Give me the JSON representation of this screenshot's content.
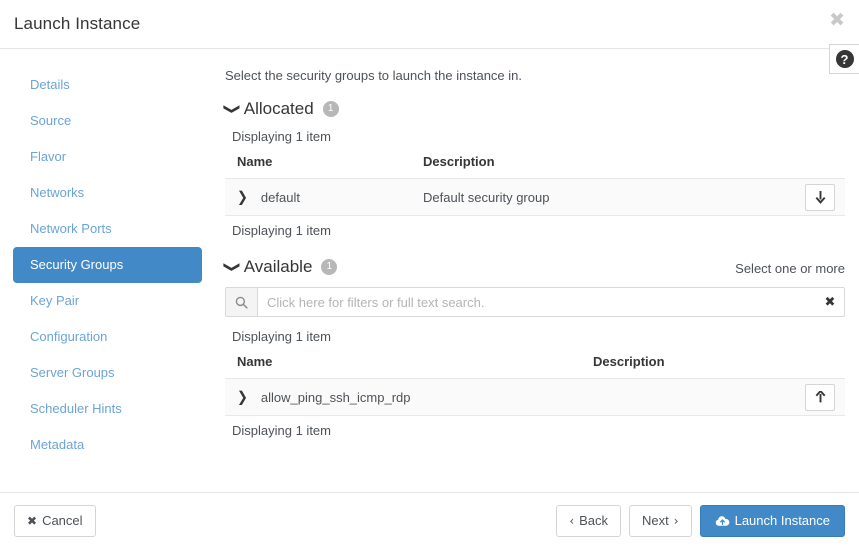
{
  "window": {
    "title": "Launch Instance",
    "close_label": "✖",
    "help_label": "?"
  },
  "sidebar": {
    "items": [
      {
        "label": "Details",
        "active": false
      },
      {
        "label": "Source",
        "active": false
      },
      {
        "label": "Flavor",
        "active": false
      },
      {
        "label": "Networks",
        "active": false
      },
      {
        "label": "Network Ports",
        "active": false
      },
      {
        "label": "Security Groups",
        "active": true
      },
      {
        "label": "Key Pair",
        "active": false
      },
      {
        "label": "Configuration",
        "active": false
      },
      {
        "label": "Server Groups",
        "active": false
      },
      {
        "label": "Scheduler Hints",
        "active": false
      },
      {
        "label": "Metadata",
        "active": false
      }
    ]
  },
  "main": {
    "intro": "Select the security groups to launch the instance in.",
    "allocated": {
      "title": "Allocated",
      "badge": "1",
      "count_top": "Displaying 1 item",
      "count_bottom": "Displaying 1 item",
      "columns": {
        "name": "Name",
        "description": "Description"
      },
      "rows": [
        {
          "name": "default",
          "description": "Default security group",
          "action_icon": "arrow-down-icon"
        }
      ]
    },
    "available": {
      "title": "Available",
      "badge": "1",
      "hint": "Select one or more",
      "count_top": "Displaying 1 item",
      "count_bottom": "Displaying 1 item",
      "search_placeholder": "Click here for filters or full text search.",
      "search_value": "",
      "search_clear_label": "✖",
      "columns": {
        "name": "Name",
        "description": "Description"
      },
      "rows": [
        {
          "name": "allow_ping_ssh_icmp_rdp",
          "description": "",
          "action_icon": "arrow-up-icon"
        }
      ]
    }
  },
  "footer": {
    "cancel": "Cancel",
    "cancel_icon": "✖",
    "back": "Back",
    "back_icon": "‹",
    "next": "Next",
    "next_icon": "›",
    "launch": "Launch Instance"
  },
  "colors": {
    "accent": "#4189c7",
    "link": "#6ba4d6",
    "text": "#4d5258",
    "heading": "#363636",
    "badge_bg": "#b7b7b7",
    "row_bg": "#fafafa",
    "border": "#e5e5e5"
  }
}
